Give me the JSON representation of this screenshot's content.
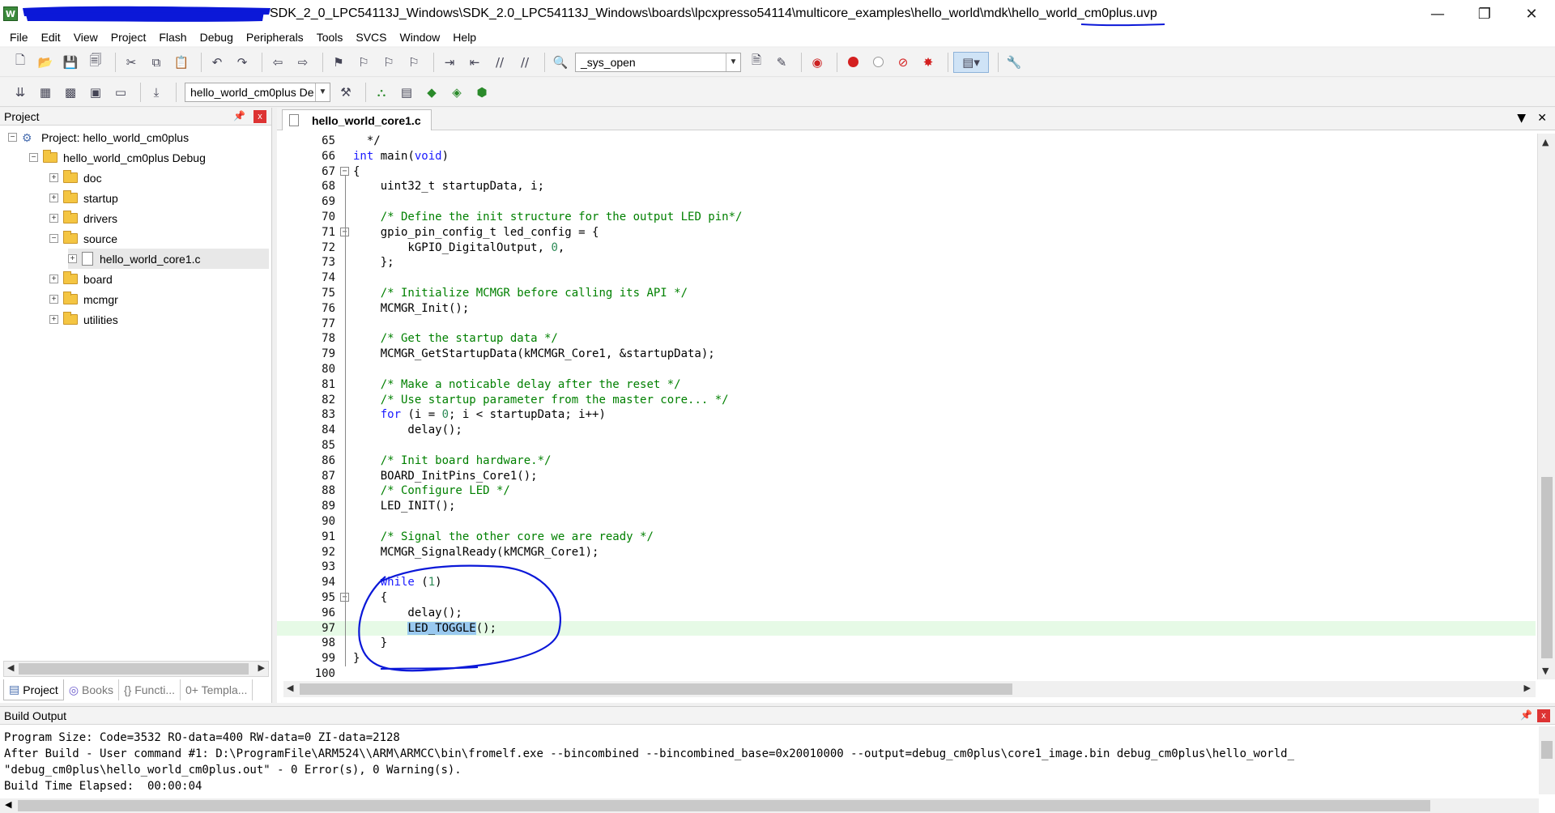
{
  "window": {
    "title": "SDK_2_0_LPC54113J_Windows\\SDK_2.0_LPC54113J_Windows\\boards\\lpcxpresso54114\\multicore_examples\\hello_world\\mdk\\hello_world_cm0plus.uvp",
    "app_icon_label": "W",
    "min": "—",
    "restore": "❐",
    "close": "✕"
  },
  "menu": [
    "File",
    "Edit",
    "View",
    "Project",
    "Flash",
    "Debug",
    "Peripherals",
    "Tools",
    "SVCS",
    "Window",
    "Help"
  ],
  "toolbar1": {
    "find_combo": "_sys_open"
  },
  "toolbar2": {
    "target_combo": "hello_world_cm0plus De"
  },
  "project_panel": {
    "title": "Project",
    "pin": "ᵖ",
    "close": "x",
    "tree": [
      {
        "label": "Project: hello_world_cm0plus",
        "level": 0,
        "expander": "−",
        "icon": "project"
      },
      {
        "label": "hello_world_cm0plus Debug",
        "level": 1,
        "expander": "−",
        "icon": "target"
      },
      {
        "label": "doc",
        "level": 2,
        "expander": "+",
        "icon": "folder"
      },
      {
        "label": "startup",
        "level": 2,
        "expander": "+",
        "icon": "folder"
      },
      {
        "label": "drivers",
        "level": 2,
        "expander": "+",
        "icon": "folder"
      },
      {
        "label": "source",
        "level": 2,
        "expander": "−",
        "icon": "folder"
      },
      {
        "label": "hello_world_core1.c",
        "level": 3,
        "expander": "+",
        "icon": "file",
        "selected": true
      },
      {
        "label": "board",
        "level": 2,
        "expander": "+",
        "icon": "folder"
      },
      {
        "label": "mcmgr",
        "level": 2,
        "expander": "+",
        "icon": "folder"
      },
      {
        "label": "utilities",
        "level": 2,
        "expander": "+",
        "icon": "folder"
      }
    ],
    "tabs": [
      "Project",
      "Books",
      "{} Functi...",
      "0+ Templa..."
    ]
  },
  "editor": {
    "tab_label": "hello_world_core1.c",
    "highlight_line": 97,
    "lines": [
      {
        "n": "65",
        "code": "  */"
      },
      {
        "n": "66",
        "code": "int main(void)"
      },
      {
        "n": "67",
        "code": "{"
      },
      {
        "n": "68",
        "code": "    uint32_t startupData, i;"
      },
      {
        "n": "69",
        "code": ""
      },
      {
        "n": "70",
        "code": "    /* Define the init structure for the output LED pin*/"
      },
      {
        "n": "71",
        "code": "    gpio_pin_config_t led_config = {"
      },
      {
        "n": "72",
        "code": "        kGPIO_DigitalOutput, 0,"
      },
      {
        "n": "73",
        "code": "    };"
      },
      {
        "n": "74",
        "code": ""
      },
      {
        "n": "75",
        "code": "    /* Initialize MCMGR before calling its API */"
      },
      {
        "n": "76",
        "code": "    MCMGR_Init();"
      },
      {
        "n": "77",
        "code": ""
      },
      {
        "n": "78",
        "code": "    /* Get the startup data */"
      },
      {
        "n": "79",
        "code": "    MCMGR_GetStartupData(kMCMGR_Core1, &startupData);"
      },
      {
        "n": "80",
        "code": ""
      },
      {
        "n": "81",
        "code": "    /* Make a noticable delay after the reset */"
      },
      {
        "n": "82",
        "code": "    /* Use startup parameter from the master core... */"
      },
      {
        "n": "83",
        "code": "    for (i = 0; i < startupData; i++)"
      },
      {
        "n": "84",
        "code": "        delay();"
      },
      {
        "n": "85",
        "code": ""
      },
      {
        "n": "86",
        "code": "    /* Init board hardware.*/"
      },
      {
        "n": "87",
        "code": "    BOARD_InitPins_Core1();"
      },
      {
        "n": "88",
        "code": "    /* Configure LED */"
      },
      {
        "n": "89",
        "code": "    LED_INIT();"
      },
      {
        "n": "90",
        "code": ""
      },
      {
        "n": "91",
        "code": "    /* Signal the other core we are ready */"
      },
      {
        "n": "92",
        "code": "    MCMGR_SignalReady(kMCMGR_Core1);"
      },
      {
        "n": "93",
        "code": ""
      },
      {
        "n": "94",
        "code": "    while (1)"
      },
      {
        "n": "95",
        "code": "    {"
      },
      {
        "n": "96",
        "code": "        delay();"
      },
      {
        "n": "97",
        "code": "        LED_TOGGLE();"
      },
      {
        "n": "98",
        "code": "    }"
      },
      {
        "n": "99",
        "code": "}"
      },
      {
        "n": "100",
        "code": ""
      }
    ]
  },
  "build_output": {
    "title": "Build Output",
    "lines": [
      "Program Size: Code=3532 RO-data=400 RW-data=0 ZI-data=2128",
      "After Build - User command #1: D:\\ProgramFile\\ARM524\\\\ARM\\ARMCC\\bin\\fromelf.exe --bincombined --bincombined_base=0x20010000 --output=debug_cm0plus\\core1_image.bin debug_cm0plus\\hello_world_",
      "\"debug_cm0plus\\hello_world_cm0plus.out\" - 0 Error(s), 0 Warning(s).",
      "Build Time Elapsed:  00:00:04"
    ]
  },
  "colors": {
    "keyword": "#1a1aff",
    "comment": "#008000",
    "number": "#2e8b57",
    "highlight_line": "#e6fae6",
    "selection": "#99c9ef",
    "annotation": "#0b18d8"
  }
}
